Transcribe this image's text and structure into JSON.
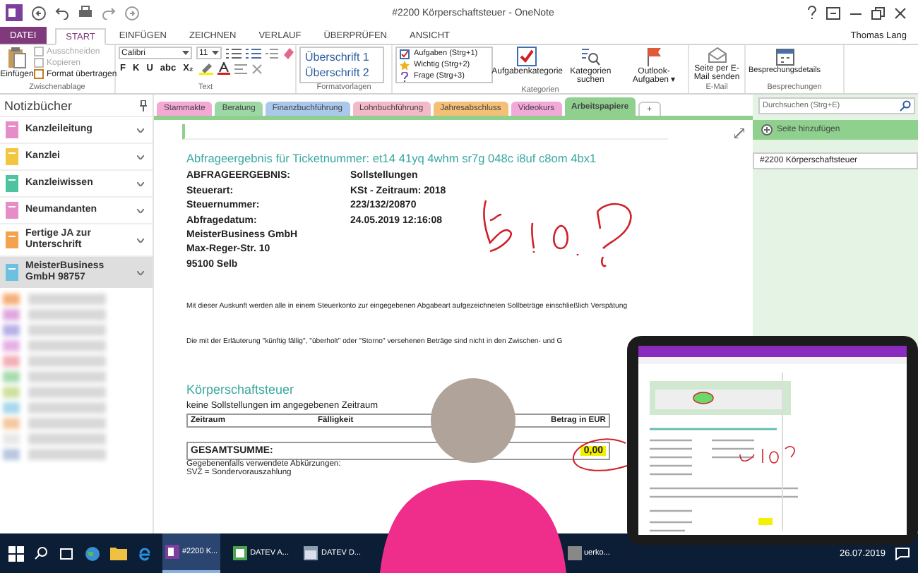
{
  "window": {
    "title": "#2200 Körperschaftsteuer - OneNote",
    "user": "Thomas Lang"
  },
  "ribbon_tabs": [
    {
      "label": "DATEI",
      "kind": "file",
      "selected": false
    },
    {
      "label": "START",
      "kind": "tab",
      "selected": true
    },
    {
      "label": "EINFÜGEN",
      "kind": "tab",
      "selected": false
    },
    {
      "label": "ZEICHNEN",
      "kind": "tab",
      "selected": false
    },
    {
      "label": "VERLAUF",
      "kind": "tab",
      "selected": false
    },
    {
      "label": "ÜBERPRÜFEN",
      "kind": "tab",
      "selected": false
    },
    {
      "label": "ANSICHT",
      "kind": "tab",
      "selected": false
    }
  ],
  "ribbon": {
    "clipboard": {
      "label": "Zwischenablage",
      "paste": "Einfügen",
      "items": [
        {
          "label": "Ausschneiden",
          "disabled": true
        },
        {
          "label": "Kopieren",
          "disabled": true
        },
        {
          "label": "Format übertragen",
          "disabled": false
        }
      ]
    },
    "text": {
      "label": "Text",
      "font": "Calibri",
      "size": "11",
      "format_buttons": [
        "F",
        "K",
        "U",
        "abc",
        "X₂"
      ]
    },
    "styles": {
      "label": "Formatvorlagen",
      "items": [
        "Überschrift 1",
        "Überschrift 2"
      ]
    },
    "tags": {
      "label": "Kategorien",
      "items": [
        {
          "label": "Aufgaben (Strg+1)",
          "kind": "checkbox"
        },
        {
          "label": "Wichtig (Strg+2)",
          "kind": "star"
        },
        {
          "label": "Frage (Strg+3)",
          "kind": "question"
        }
      ],
      "buttons": [
        {
          "label": "Aufgabenkategorie",
          "kind": "check"
        },
        {
          "label": "Kategorien suchen",
          "kind": "find"
        },
        {
          "label": "Outlook-Aufgaben ▾",
          "kind": "flag"
        }
      ]
    },
    "email": {
      "label": "E-Mail",
      "button": "Seite per E-Mail senden"
    },
    "meetings": {
      "label": "Besprechungen",
      "button": "Besprechungsdetails"
    }
  },
  "notebooks": {
    "title": "Notizbücher",
    "items": [
      {
        "label": "Kanzleileitung",
        "color": "#e68cc6",
        "selected": false
      },
      {
        "label": "Kanzlei",
        "color": "#f3c63f",
        "selected": false
      },
      {
        "label": "Kanzleiwissen",
        "color": "#4fc3a0",
        "selected": false
      },
      {
        "label": "Neumandanten",
        "color": "#e68cc6",
        "selected": false
      },
      {
        "label": "Fertige JA zur Unterschrift",
        "color": "#f4a24e",
        "selected": false
      },
      {
        "label": "MeisterBusiness GmbH 98757",
        "color": "#6cc0e0",
        "selected": true
      }
    ]
  },
  "section_tabs": [
    {
      "label": "Stammakte",
      "color": "#f3a9d3",
      "selected": false
    },
    {
      "label": "Beratung",
      "color": "#9ed7a6",
      "selected": false
    },
    {
      "label": "Finanzbuchführung",
      "color": "#a9c8ec",
      "selected": false
    },
    {
      "label": "Lohnbuchführung",
      "color": "#f4b9c9",
      "selected": false
    },
    {
      "label": "Jahresabschluss",
      "color": "#f5bf78",
      "selected": false
    },
    {
      "label": "Videokurs",
      "color": "#f2a8d8",
      "selected": false
    },
    {
      "label": "Arbeitspapiere",
      "color": "#8fd08f",
      "selected": true
    }
  ],
  "add_section": "+",
  "page": {
    "heading": "Abfrageergebnis für Ticketnummer: et14 41yq 4whm sr7g 048c i8uf c8om 4bx1",
    "fields": [
      {
        "label": "ABFRAGEERGEBNIS:",
        "value": "Sollstellungen"
      },
      {
        "label": "Steuerart:",
        "value": "KSt - Zeitraum: 2018"
      },
      {
        "label": "Steuernummer:",
        "value": "223/132/20870"
      },
      {
        "label": "Abfragedatum:",
        "value": "24.05.2019 12:16:08"
      }
    ],
    "address": [
      "MeisterBusiness GmbH",
      "Max-Reger-Str. 10",
      "95100 Selb"
    ],
    "paragraphs": [
      "Mit dieser Auskunft werden alle in einem Steuerkonto zur eingegebenen Abgabeart aufgezeichneten Sollbeträge einschließlich Verspätung",
      "Die mit der Erläuterung \"künftig fällig\", \"überholt\" oder \"Storno\" versehenen Beträge sind nicht in den Zwischen- und G"
    ],
    "section_heading": "Körperschaftsteuer",
    "section_note": "keine Sollstellungen im angegebenen Zeitraum",
    "table": {
      "columns": [
        "Zeitraum",
        "Fälligkeit",
        "Betrag in EUR"
      ],
      "total_label": "GESAMTSUMME:",
      "total_value": "0,00"
    },
    "abbreviations": [
      "Gegebenenfalls verwendete Abkürzungen:",
      "SVZ = Sondervorauszahlung"
    ]
  },
  "pages_panel": {
    "search_placeholder": "Durchsuchen (Strg+E)",
    "add_page": "Seite hinzufügen",
    "pages": [
      {
        "label": "#2200 Körperschaftsteuer",
        "selected": true
      }
    ]
  },
  "taskbar": {
    "apps": [
      {
        "label": "#2200 K...",
        "kind": "onenote",
        "selected": true
      },
      {
        "label": "DATEV A...",
        "kind": "datev",
        "selected": false
      },
      {
        "label": "DATEV D...",
        "kind": "datev2",
        "selected": false
      },
      {
        "label": "uerko...",
        "kind": "doc",
        "selected": false
      }
    ],
    "date": "26.07.2019"
  }
}
